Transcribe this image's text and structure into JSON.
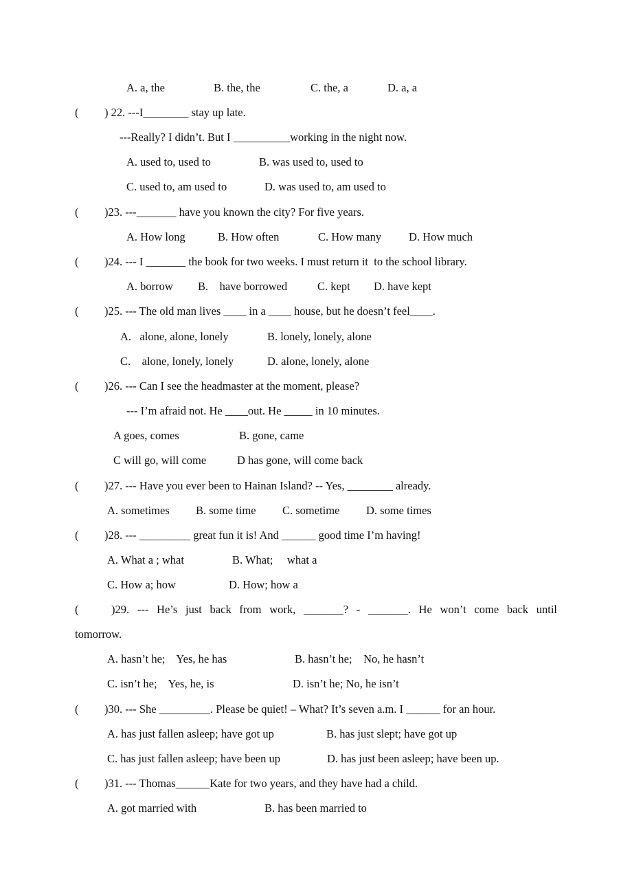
{
  "q21_options": [
    "A. a, the",
    "B. the, the",
    "C. the, a",
    "D. a, a"
  ],
  "questions": {
    "q22": {
      "paren": "(",
      "stem": ") 22. ---I________ stay up late.",
      "reply": "---Really? I didn’t. But I __________working in the night now.",
      "options": [
        "A. used to, used to",
        "B. was used to, used to",
        "C. used to, am used to",
        "D. was used to, am used to"
      ]
    },
    "q23": {
      "paren": "(",
      "stem": ")23. ---_______ have you known the city? For five years.",
      "options": [
        "A. How long",
        "B. How often",
        "C. How many",
        "D. How much"
      ]
    },
    "q24": {
      "paren": "(",
      "stem": ")24. --- I _______ the book for two weeks. I must return it  to the school library.",
      "options": [
        "A. borrow",
        "B.    have borrowed",
        "C. kept",
        "D. have kept"
      ]
    },
    "q25": {
      "paren": "(",
      "stem": ")25. --- The old man lives ____ in a ____ house, but he doesn’t feel____.",
      "options": [
        "A.   alone, alone, lonely",
        "B. lonely, lonely, alone",
        "C.    alone, lonely, lonely",
        "D. alone, lonely, alone"
      ]
    },
    "q26": {
      "paren": "(",
      "stem": ")26. --- Can I see the headmaster at the moment, please?",
      "reply": "--- I’m afraid not. He ____out. He _____ in 10 minutes.",
      "options": [
        "A goes, comes",
        "B. gone, came",
        "C will go, will come",
        "D has gone, will come back"
      ]
    },
    "q27": {
      "paren": "(",
      "stem": ")27. --- Have you ever been to Hainan Island? -- Yes, ________ already.",
      "options": [
        "A. sometimes",
        "B. some time",
        "C. sometime",
        "D. some times"
      ]
    },
    "q28": {
      "paren": "(",
      "stem": ")28. --- _________ great fun it is! And ______ good time I’m having!",
      "options": [
        "A. What a ; what",
        "B. What;     what a",
        "C. How a; how",
        "D. How; how a"
      ]
    },
    "q29": {
      "paren": "(",
      "stem_line1": ")29. --- He’s just back from work, _______? - _______. He won’t come back until",
      "stem_line2": "tomorrow.",
      "options": [
        "A. hasn’t he;    Yes, he has",
        "B. hasn’t he;    No, he hasn’t",
        "C. isn’t he;    Yes, he, is",
        "D. isn’t he; No, he isn’t"
      ]
    },
    "q30": {
      "paren": "(",
      "stem": ")30. --- She _________. Please be quiet! – What? It’s seven a.m. I ______ for an hour.",
      "options": [
        "A. has just fallen asleep; have got up",
        "B. has just slept; have got up",
        "C. has just fallen asleep; have been up",
        "D. has just been asleep; have been up."
      ]
    },
    "q31": {
      "paren": "(",
      "stem": ")31. --- Thomas______Kate for two years, and they have had a child.",
      "options": [
        "A. got married with",
        "B. has been married to"
      ]
    }
  }
}
